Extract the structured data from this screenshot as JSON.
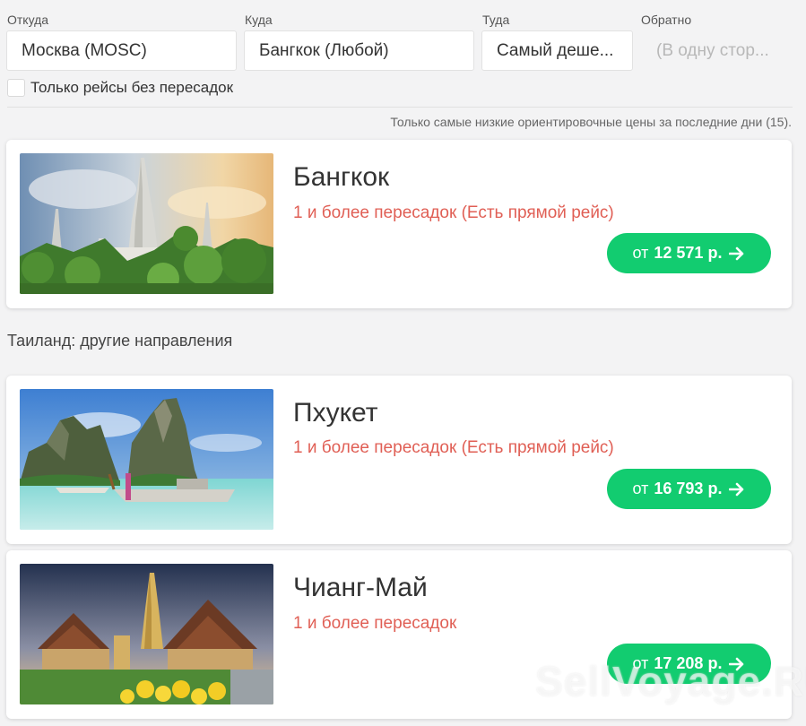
{
  "search": {
    "from": {
      "label": "Откуда",
      "value": "Москва (MOSC)"
    },
    "to": {
      "label": "Куда",
      "value": "Бангкок (Любой)"
    },
    "depart": {
      "label": "Туда",
      "value": "Самый деше..."
    },
    "return": {
      "label": "Обратно",
      "placeholder": "(В одну стор..."
    },
    "direct_only": {
      "label": "Только рейсы без пересадок",
      "checked": false
    }
  },
  "note": "Только самые низкие ориентировочные цены за последние дни (15).",
  "main_result": {
    "city": "Бангкок",
    "stops": "1 и более пересадок (Есть прямой рейс)",
    "price_prefix": "от",
    "price": "12 571 р."
  },
  "section_title": "Таиланд: другие направления",
  "other_results": [
    {
      "city": "Пхукет",
      "stops": "1 и более пересадок (Есть прямой рейс)",
      "price_prefix": "от",
      "price": "16 793 р."
    },
    {
      "city": "Чианг-Май",
      "stops": "1 и более пересадок",
      "price_prefix": "от",
      "price": "17 208 р."
    }
  ],
  "watermark": "SellVoyage.RU",
  "colors": {
    "accent": "#12cc70",
    "stops_text": "#e05f55",
    "background": "#f3f3f4"
  },
  "icons": {
    "price_arrow": "arrow-right-icon"
  }
}
